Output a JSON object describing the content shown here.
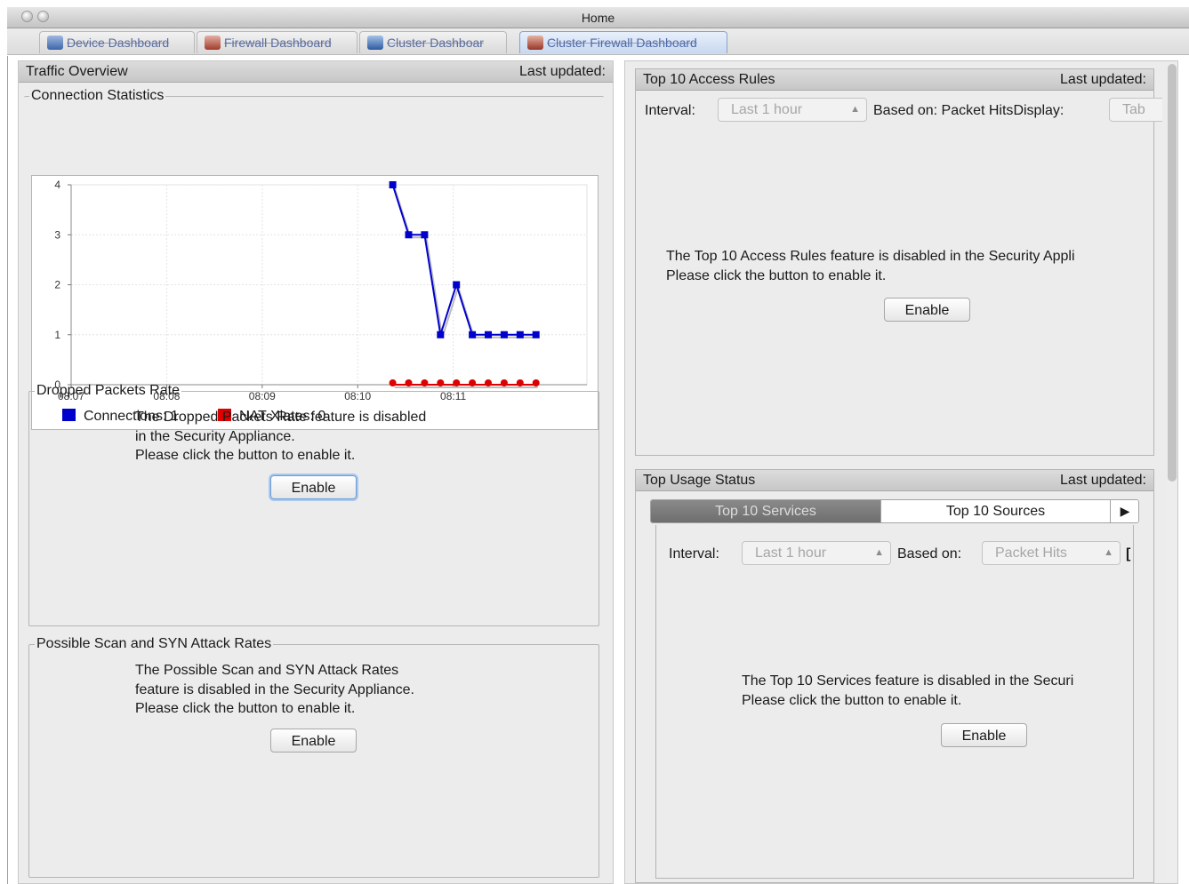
{
  "window": {
    "title": "Home"
  },
  "tabs": [
    {
      "label": "Device Dashboard",
      "active": false
    },
    {
      "label": "Firewall Dashboard",
      "active": false
    },
    {
      "label": "Cluster Dashboar",
      "active": false
    },
    {
      "label": "Cluster Firewall Dashboard",
      "active": true
    }
  ],
  "traffic": {
    "title": "Traffic Overview",
    "last_updated": "Last updated:",
    "connection_stats": {
      "legend": "Connection Statistics"
    },
    "dropped": {
      "legend": "Dropped Packets Rate",
      "lines": [
        "The Dropped Packets Rate feature is disabled",
        "in the Security Appliance.",
        "Please click the button to enable it."
      ],
      "button": "Enable"
    },
    "scan": {
      "legend": "Possible Scan and SYN Attack Rates",
      "lines": [
        "The Possible Scan and SYN Attack Rates",
        "feature is disabled in the Security Appliance.",
        "Please click the button to enable it."
      ],
      "button": "Enable"
    }
  },
  "access_rules": {
    "title": "Top 10 Access Rules",
    "last_updated": "Last updated:",
    "interval_label": "Interval:",
    "interval_value": "Last 1 hour",
    "based_on": "Based on:",
    "based_on_value": "Packet Hits",
    "display_label": "Display:",
    "display_value": "Tab",
    "lines": [
      "The Top 10 Access Rules feature is disabled in the Security Appli",
      "Please click the button to enable it."
    ],
    "button": "Enable"
  },
  "usage": {
    "title": "Top Usage Status",
    "last_updated": "Last updated:",
    "tabs": [
      "Top 10 Services",
      "Top 10 Sources"
    ],
    "more_icon": "▶",
    "interval_label": "Interval:",
    "interval_value": "Last 1 hour",
    "based_on": "Based on:",
    "based_on_value": "Packet Hits",
    "clipped_char": "[",
    "lines": [
      "The Top 10 Services feature is disabled in the Securi",
      "Please click the button to enable it."
    ],
    "button": "Enable"
  },
  "chart_data": {
    "type": "line",
    "x": [
      "08:10:22",
      "08:10:32",
      "08:10:42",
      "08:10:52",
      "08:11:02",
      "08:11:12",
      "08:11:22",
      "08:11:32",
      "08:11:42",
      "08:11:52"
    ],
    "x_ticks": [
      "08:07",
      "08:08",
      "08:09",
      "08:10",
      "08:11"
    ],
    "y_ticks": [
      "0",
      "1",
      "2",
      "3",
      "4"
    ],
    "ylim": [
      0,
      4
    ],
    "grid": true,
    "series": [
      {
        "name": "Connections",
        "color": "#0000cc",
        "values": [
          4,
          3,
          3,
          1,
          2,
          1,
          1,
          1,
          1,
          1
        ]
      },
      {
        "name": "NAT Xlates",
        "color": "#dd0000",
        "values": [
          0,
          0,
          0,
          0,
          0,
          0,
          0,
          0,
          0,
          0
        ]
      }
    ],
    "legend": [
      {
        "label": "Connections: 1",
        "color": "#0000cc"
      },
      {
        "label": "NAT Xlates: 0",
        "color": "#dd0000"
      }
    ],
    "legend_position": "bottom-left"
  }
}
